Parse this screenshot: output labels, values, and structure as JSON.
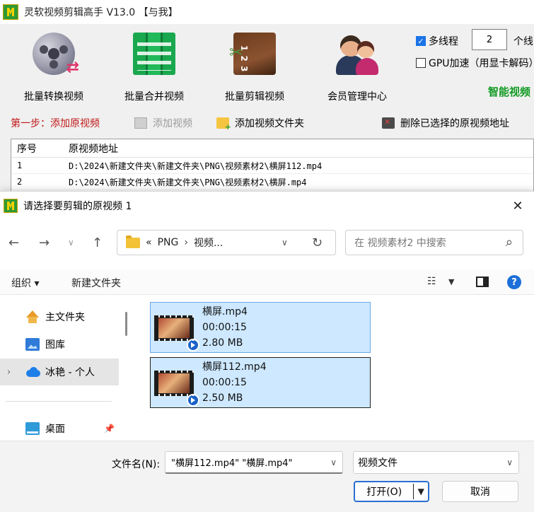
{
  "app": {
    "title": "灵软视频剪辑高手 V13.0  【与我】",
    "tools": [
      {
        "label": "批量转换视频",
        "icon": "film-reel-convert-icon"
      },
      {
        "label": "批量合并视频",
        "icon": "film-strips-merge-icon"
      },
      {
        "label": "批量剪辑视频",
        "icon": "clapperboard-scissors-icon"
      },
      {
        "label": "会员管理中心",
        "icon": "users-icon"
      }
    ],
    "options": {
      "multithread_label": "多线程",
      "multithread_checked": true,
      "thread_count": "2",
      "thread_unit": "个线",
      "gpu_label": "GPU加速（用显卡解码）",
      "gpu_checked": false
    },
    "smart_label": "智能视频",
    "step": {
      "title": "第一步：添加原视频",
      "add_video": "添加视频",
      "add_folder": "添加视频文件夹",
      "delete_selected": "删除已选择的原视频地址"
    },
    "table": {
      "headers": [
        "序号",
        "原视频地址"
      ],
      "rows": [
        [
          "1",
          "D:\\2024\\新建文件夹\\新建文件夹\\PNG\\视频素材2\\横屏112.mp4"
        ],
        [
          "2",
          "D:\\2024\\新建文件夹\\新建文件夹\\PNG\\视频素材2\\横屏.mp4"
        ]
      ]
    }
  },
  "dialog": {
    "title": "请选择要剪辑的原视频 1",
    "address": {
      "prefix": "«",
      "crumb1": "PNG",
      "sep": "›",
      "crumb2": "视频..."
    },
    "search_placeholder": "在 视频素材2 中搜索",
    "commands": {
      "organize": "组织 ▾",
      "new_folder": "新建文件夹"
    },
    "sidebar": [
      {
        "label": "主文件夹",
        "icon": "home-icon"
      },
      {
        "label": "图库",
        "icon": "pictures-icon"
      },
      {
        "label": "冰艳 - 个人",
        "icon": "cloud-icon"
      },
      {
        "label": "桌面",
        "icon": "desktop-icon"
      }
    ],
    "files": [
      {
        "name": "横屏.mp4",
        "duration": "00:00:15",
        "size": "2.80 MB"
      },
      {
        "name": "横屏112.mp4",
        "duration": "00:00:15",
        "size": "2.50 MB"
      }
    ],
    "footer": {
      "filename_label": "文件名(N):",
      "filename_value": "\"横屏112.mp4\" \"横屏.mp4\"",
      "filetype": "视频文件",
      "open_label": "打开(O)",
      "cancel_label": "取消"
    }
  }
}
